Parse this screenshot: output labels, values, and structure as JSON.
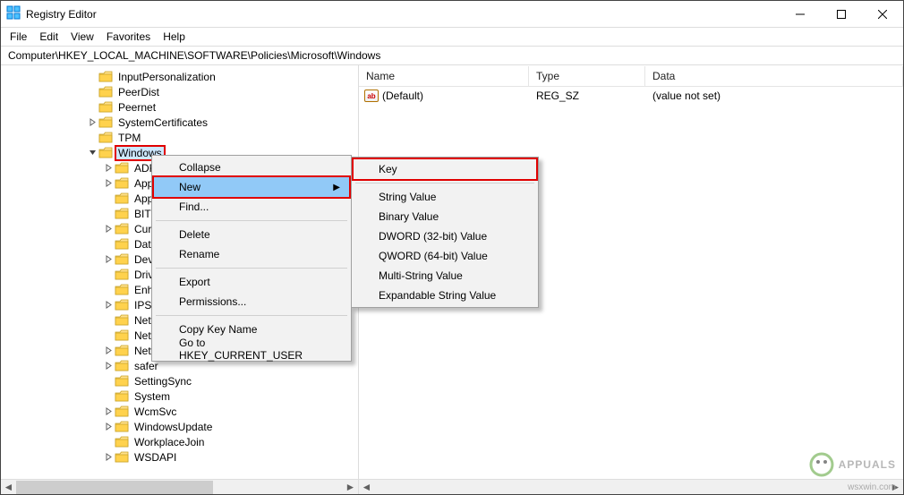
{
  "window": {
    "title": "Registry Editor"
  },
  "menubar": [
    "File",
    "Edit",
    "View",
    "Favorites",
    "Help"
  ],
  "address": "Computer\\HKEY_LOCAL_MACHINE\\SOFTWARE\\Policies\\Microsoft\\Windows",
  "tree_indent_base": 80,
  "tree": [
    {
      "label": "InputPersonalization",
      "indent": 95,
      "expander": ""
    },
    {
      "label": "PeerDist",
      "indent": 95,
      "expander": ""
    },
    {
      "label": "Peernet",
      "indent": 95,
      "expander": ""
    },
    {
      "label": "SystemCertificates",
      "indent": 95,
      "expander": ">"
    },
    {
      "label": "TPM",
      "indent": 95,
      "expander": ""
    },
    {
      "label": "Windows",
      "indent": 95,
      "expander": "v",
      "selected": true,
      "highlight": true
    },
    {
      "label": "ADR",
      "indent": 113,
      "expander": ">"
    },
    {
      "label": "AppP",
      "indent": 113,
      "expander": ">",
      "cut": true
    },
    {
      "label": "Appx",
      "indent": 113,
      "expander": "",
      "cut": true
    },
    {
      "label": "BITS",
      "indent": 113,
      "expander": "",
      "cut": true
    },
    {
      "label": "Curre",
      "indent": 113,
      "expander": ">",
      "cut": true
    },
    {
      "label": "DataC",
      "indent": 113,
      "expander": "",
      "cut": true
    },
    {
      "label": "Devic",
      "indent": 113,
      "expander": ">",
      "cut": true
    },
    {
      "label": "Drive",
      "indent": 113,
      "expander": "",
      "cut": true
    },
    {
      "label": "Enhar",
      "indent": 113,
      "expander": "",
      "cut": true
    },
    {
      "label": "IPSec",
      "indent": 113,
      "expander": ">",
      "cut": true
    },
    {
      "label": "Netw",
      "indent": 113,
      "expander": "",
      "cut": true
    },
    {
      "label": "Netw",
      "indent": 113,
      "expander": "",
      "cut": true
    },
    {
      "label": "NetworkProvider",
      "indent": 113,
      "expander": ">"
    },
    {
      "label": "safer",
      "indent": 113,
      "expander": ">"
    },
    {
      "label": "SettingSync",
      "indent": 113,
      "expander": ""
    },
    {
      "label": "System",
      "indent": 113,
      "expander": ""
    },
    {
      "label": "WcmSvc",
      "indent": 113,
      "expander": ">"
    },
    {
      "label": "WindowsUpdate",
      "indent": 113,
      "expander": ">"
    },
    {
      "label": "WorkplaceJoin",
      "indent": 113,
      "expander": ""
    },
    {
      "label": "WSDAPI",
      "indent": 113,
      "expander": ">"
    }
  ],
  "list": {
    "headers": {
      "name": "Name",
      "type": "Type",
      "data": "Data"
    },
    "rows": [
      {
        "name": "(Default)",
        "type": "REG_SZ",
        "data": "(value not set)"
      }
    ]
  },
  "context_menu": {
    "items": [
      {
        "label": "Collapse"
      },
      {
        "label": "New",
        "submenu": true,
        "hovered": true,
        "highlight": true
      },
      {
        "label": "Find..."
      },
      {
        "sep": true
      },
      {
        "label": "Delete"
      },
      {
        "label": "Rename"
      },
      {
        "sep": true
      },
      {
        "label": "Export"
      },
      {
        "label": "Permissions..."
      },
      {
        "sep": true
      },
      {
        "label": "Copy Key Name"
      },
      {
        "label": "Go to HKEY_CURRENT_USER"
      }
    ]
  },
  "submenu": {
    "items": [
      {
        "label": "Key",
        "hovered": true,
        "highlight": true
      },
      {
        "sep": true
      },
      {
        "label": "String Value"
      },
      {
        "label": "Binary Value"
      },
      {
        "label": "DWORD (32-bit) Value"
      },
      {
        "label": "QWORD (64-bit) Value"
      },
      {
        "label": "Multi-String Value"
      },
      {
        "label": "Expandable String Value"
      }
    ]
  },
  "watermark": {
    "text": "APPUALS",
    "url": "wsxwin.com"
  }
}
